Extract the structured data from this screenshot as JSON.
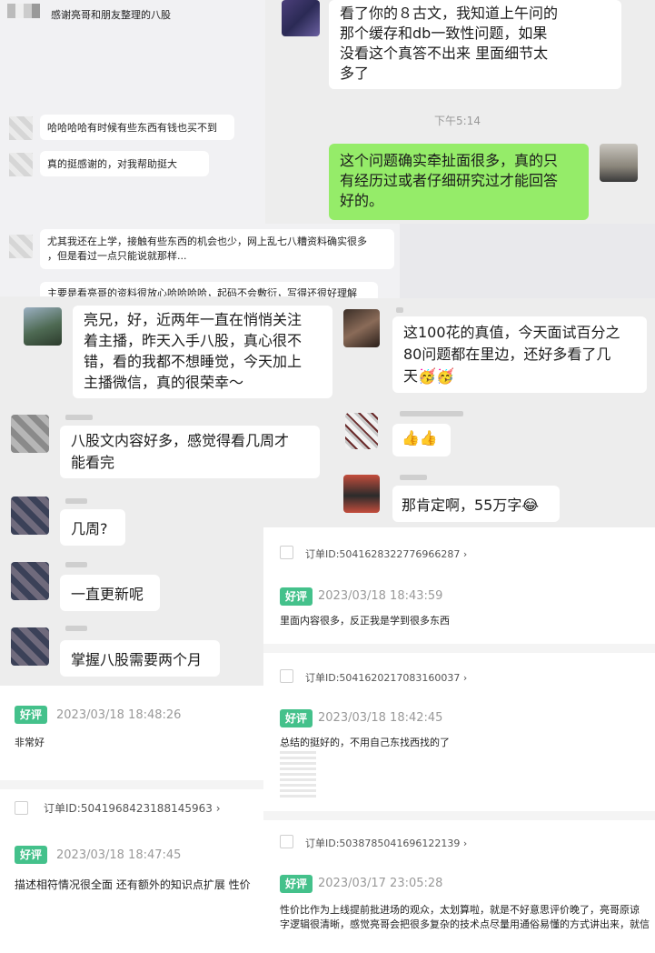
{
  "top_left_chat": {
    "header_text": "感谢亮哥和朋友整理的八股",
    "msg1": "哈哈哈哈有时候有些东西有钱也买不到",
    "msg2": "真的挺感谢的，对我帮助挺大",
    "msg3_line1": "尤其我还在上学，接触有些东西的机会也少，网上乱七八糟资料确实很多",
    "msg3_line2": "，但是看过一点只能说就那样...",
    "msg4": "主要是看亮哥的资料很放心哈哈哈哈，起码不会敷衍，写得还很好理解"
  },
  "top_right_chat": {
    "incoming_line1": "看了你的８古文，我知道上午问的",
    "incoming_line2": "那个缓存和db一致性问题，如果",
    "incoming_line3": "没看这个真答不出来 里面细节太",
    "incoming_line4": "多了",
    "time": "下午5:14",
    "reply_line1": "这个问题确实牵扯面很多，真的只",
    "reply_line2": "有经历过或者仔细研究过才能回答",
    "reply_line3": "好的。"
  },
  "mid_left_chat": {
    "msg1_line1": "亮兄，好，近两年一直在悄悄关注",
    "msg1_line2": "着主播，昨天入手八股，真心很不",
    "msg1_line3": "错，看的我都不想睡觉，今天加上",
    "msg1_line4": "主播微信，真的很荣幸～",
    "msg2_line1": "八股文内容好多，感觉得看几周才",
    "msg2_line2": "能看完",
    "msg3": "几周?",
    "msg4": "一直更新呢",
    "msg5": "掌握八股需要两个月"
  },
  "mid_right_chat": {
    "msg1_line1": "这100花的真值，今天面试百分之",
    "msg1_line2": "80问题都在里边，还好多看了几",
    "msg1_line3": "天",
    "msg1_emoji": "🥳🥳",
    "msg2_emoji": "👍👍",
    "msg3": "那肯定啊，55万字",
    "msg3_emoji": "😂"
  },
  "reviews_right": [
    {
      "order": "订单ID:5041628322776966287 ›",
      "tag": "好评",
      "date": "2023/03/18 18:43:59",
      "text": "里面内容很多，反正我是学到很多东西"
    },
    {
      "order": "订单ID:5041620217083160037 ›",
      "tag": "好评",
      "date": "2023/03/18 18:42:45",
      "text": "总结的挺好的，不用自己东找西找的了"
    },
    {
      "order": "订单ID:5038785041696122139 ›",
      "tag": "好评",
      "date": "2023/03/17 23:05:28",
      "text_line1": "性价比作为上线提前批进场的观众，太划算啦，就是不好意思评价晚了，亮哥原谅",
      "text_line2": "字逻辑很清晰，感觉亮哥会把很多复杂的技术点尽量用通俗易懂的方式讲出来，就信"
    }
  ],
  "reviews_left": [
    {
      "tag": "好评",
      "date": "2023/03/18 18:48:26",
      "text": "非常好"
    },
    {
      "order": "订单ID:5041968423188145963 ›",
      "tag": "好评",
      "date": "2023/03/18 18:47:45",
      "text": "描述相符情况很全面 还有额外的知识点扩展 性价"
    }
  ],
  "colors": {
    "wechat_green": "#95ec69",
    "review_tag": "#44c18b"
  }
}
